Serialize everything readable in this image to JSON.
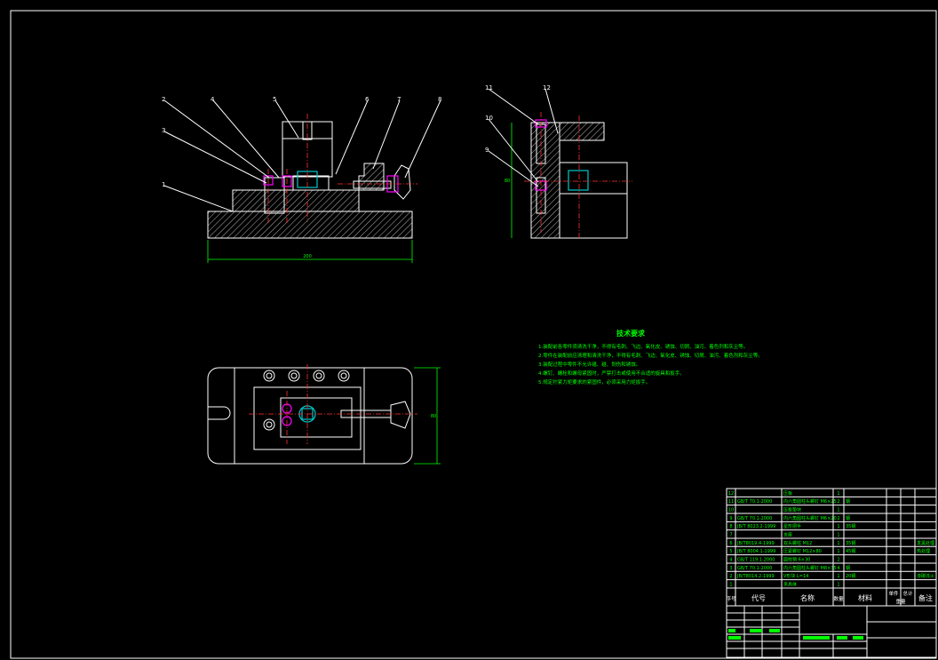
{
  "views": {
    "front": {
      "callouts": [
        "2",
        "4",
        "5",
        "6",
        "7",
        "8",
        "3",
        "1"
      ],
      "dim_width": "200"
    },
    "side": {
      "callouts": [
        "11",
        "12",
        "10",
        "9"
      ],
      "dim_height": "80"
    },
    "top": {
      "dim_height": "80"
    }
  },
  "tech_req": {
    "title": "技术要求",
    "lines": [
      "1.装配前各零件须清洗干净，不得有毛刺、飞边、氧化皮、锈蚀、切屑、油污、着色剂和灰尘等。",
      "2.零件在装配前应清理和清洗干净，不得有毛刺、飞边、氧化皮、锈蚀、切屑、油污、着色剂和灰尘等。",
      "3.装配过程中零件不允许磕、碰、划伤和锈蚀。",
      "4.螺钉、螺栓和螺母紧固时，严禁打击或使用不合适的旋具和扳手。",
      "5.规定拧紧力矩要求的紧固件，必须采用力矩扳手。"
    ]
  },
  "bom": {
    "rows": [
      {
        "no": "12",
        "code": "",
        "name": "压板",
        "qty": "1",
        "material": "",
        "note": ""
      },
      {
        "no": "11",
        "code": "GB/T 70.1-2000",
        "name": "内六角圆柱头螺钉 M6×25",
        "qty": "2",
        "material": "钢",
        "note": ""
      },
      {
        "no": "10",
        "code": "",
        "name": "压板垫块",
        "qty": "1",
        "material": "",
        "note": ""
      },
      {
        "no": "9",
        "code": "GB/T 70.1-2000",
        "name": "内六角圆柱头螺钉 M6×20",
        "qty": "2",
        "material": "钢",
        "note": ""
      },
      {
        "no": "8",
        "code": "JB/T 8023.2-1999",
        "name": "星形把手",
        "qty": "1",
        "material": "35钢",
        "note": ""
      },
      {
        "no": "7",
        "code": "",
        "name": "支座",
        "qty": "1",
        "material": "",
        "note": ""
      },
      {
        "no": "6",
        "code": "JB/T8019.4-1999",
        "name": "双头螺柱 M12",
        "qty": "1",
        "material": "35钢",
        "note": "发黑处理"
      },
      {
        "no": "5",
        "code": "JB/T 8004.1-1999",
        "name": "压紧螺钉 M12×80",
        "qty": "1",
        "material": "45钢",
        "note": "热处理"
      },
      {
        "no": "4",
        "code": "GB/T 119.1-2000",
        "name": "圆柱销 6×30",
        "qty": "2",
        "material": "",
        "note": ""
      },
      {
        "no": "3",
        "code": "GB/T 70.1-2000",
        "name": "内六角圆柱头螺钉 M8×35",
        "qty": "4",
        "material": "钢",
        "note": ""
      },
      {
        "no": "2",
        "code": "JB/T8014.2-1999",
        "name": "V形块 L=14",
        "qty": "1",
        "material": "20钢",
        "note": "渗碳淬火"
      },
      {
        "no": "1",
        "code": "",
        "name": "夹具体",
        "qty": "1",
        "material": "",
        "note": ""
      }
    ],
    "headers": {
      "no": "序号",
      "code": "代号",
      "name": "名称",
      "qty": "数量",
      "material": "材料",
      "unit_weight": "单件",
      "total_weight": "总计",
      "weight": "重量",
      "note": "备注"
    }
  },
  "colors": {
    "background": "#000000",
    "geometry": "#ffffff",
    "centerline": "#ff3030",
    "annotation": "#00ff00",
    "bolt": "#ff00ff",
    "nut": "#00c8c8"
  }
}
